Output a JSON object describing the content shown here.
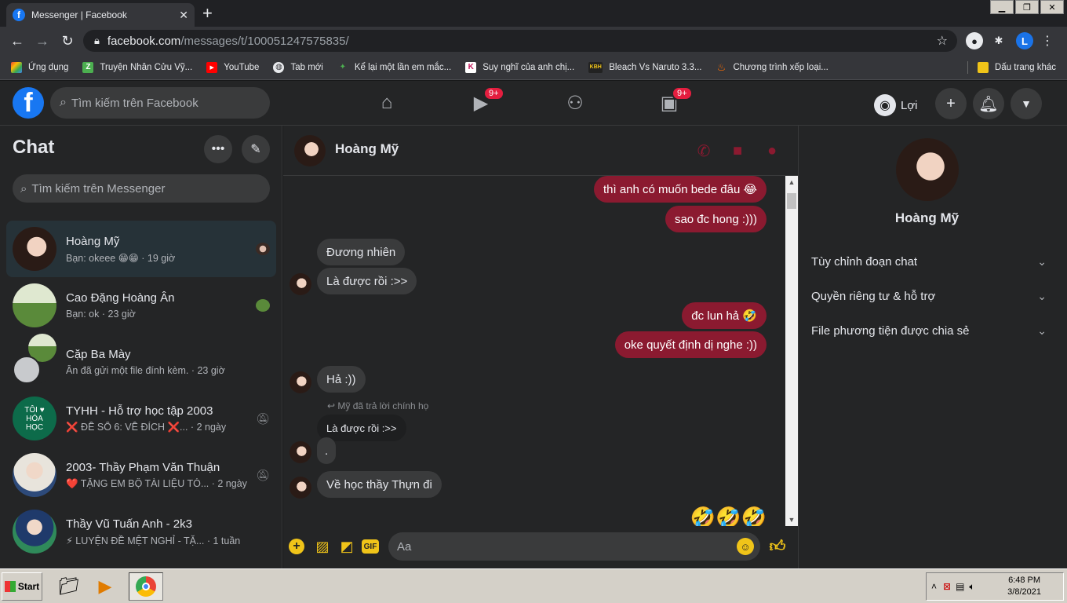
{
  "browser": {
    "tab_title": "Messenger | Facebook",
    "tab_close": "✕",
    "new_tab": "+",
    "url_domain": "facebook.com",
    "url_path": "/messages/t/100051247575835/",
    "profile_initial": "L",
    "window_buttons": [
      "▁",
      "❐",
      "✕"
    ],
    "bookmarks": [
      {
        "label": "Ứng dụng",
        "icon": "apps-grid-icon",
        "color": "#e94335"
      },
      {
        "label": "Truyện Nhân Cửu Vỹ...",
        "icon": "z-icon",
        "color": "#4caf50"
      },
      {
        "label": "YouTube",
        "icon": "youtube-icon",
        "color": "#ff0000"
      },
      {
        "label": "Tab mới",
        "icon": "globe-icon",
        "color": "#e8eaed"
      },
      {
        "label": "Kể lại một lần em mắc...",
        "icon": "mascot-icon",
        "color": "#4caf50"
      },
      {
        "label": "Suy nghĩ của anh chị...",
        "icon": "k-icon",
        "color": "#c2185b"
      },
      {
        "label": "Bleach Vs Naruto 3.3...",
        "icon": "kbh-icon",
        "color": "#333333"
      },
      {
        "label": "Chương trình xếp loại...",
        "icon": "fire-icon",
        "color": "#ff6d00"
      }
    ],
    "other_bookmarks": "Dấu trang khác"
  },
  "header": {
    "logo": "f",
    "search_placeholder": "Tìm kiếm trên Facebook",
    "watch_badge": "9+",
    "gaming_badge": "9+",
    "profile_name": "Lợi"
  },
  "sidebar": {
    "title": "Chat",
    "search_placeholder": "Tìm kiếm trên Messenger",
    "conversations": [
      {
        "name": "Hoàng Mỹ",
        "message": "Bạn: okeee 😁😁 · 19 giờ"
      },
      {
        "name": "Cao Đặng Hoàng Ân",
        "message": "Bạn: ok · 23 giờ"
      },
      {
        "name": "Cặp Ba Mày",
        "message": "Ân đã gửi một file đính kèm. · 23 giờ"
      },
      {
        "name": "TYHH - Hỗ trợ học tập 2003",
        "message": "❌ ĐỀ SỐ 6: VỀ ĐÍCH ❌... · 2 ngày"
      },
      {
        "name": "2003- Thầy Phạm Văn Thuận",
        "message": "❤️ TẶNG EM BỘ TÀI LIỆU TÓ... · 2 ngày"
      },
      {
        "name": "Thầy Vũ Tuấn Anh - 2k3",
        "message": "⚡ LUYỆN ĐỀ MỆT NGHỈ - TẶ... · 1 tuần"
      }
    ],
    "tyhh_avatar_text": "TÔI ♥ HÓA HỌC"
  },
  "chat": {
    "contact_name": "Hoàng Mỹ",
    "messages": [
      {
        "text": "thì anh có muốn bede đâu 😂",
        "dir": "out"
      },
      {
        "text": "sao đc hong :)))",
        "dir": "out"
      },
      {
        "text": "Đương nhiên",
        "dir": "in"
      },
      {
        "text": "Là được rồi :>>",
        "dir": "in"
      },
      {
        "text": "đc lun hả 🤣",
        "dir": "out"
      },
      {
        "text": "oke quyết định dị nghe  :))",
        "dir": "out"
      },
      {
        "text": "Hả :))",
        "dir": "in"
      },
      {
        "text": "Là được rồi :>>",
        "dir": "quoted"
      },
      {
        "text": ".",
        "dir": "in"
      },
      {
        "text": "Về học thầy Thựn đi",
        "dir": "in"
      }
    ],
    "reply_note": "Mỹ đã trả lời chính họ",
    "emojis": "🤣🤣🤣",
    "composer_placeholder": "Aa",
    "gif_label": "GIF"
  },
  "right_panel": {
    "name": "Hoàng Mỹ",
    "sections": [
      "Tùy chỉnh đoạn chat",
      "Quyền riêng tư & hỗ trợ",
      "File phương tiện được chia sẻ"
    ]
  },
  "taskbar": {
    "start": "Start",
    "time": "6:48 PM",
    "date": "3/8/2021"
  },
  "colors": {
    "accent": "#8b1a30",
    "fb_blue": "#1877f2",
    "badge": "#e41e3f",
    "composer_icons": "#f0c419"
  }
}
